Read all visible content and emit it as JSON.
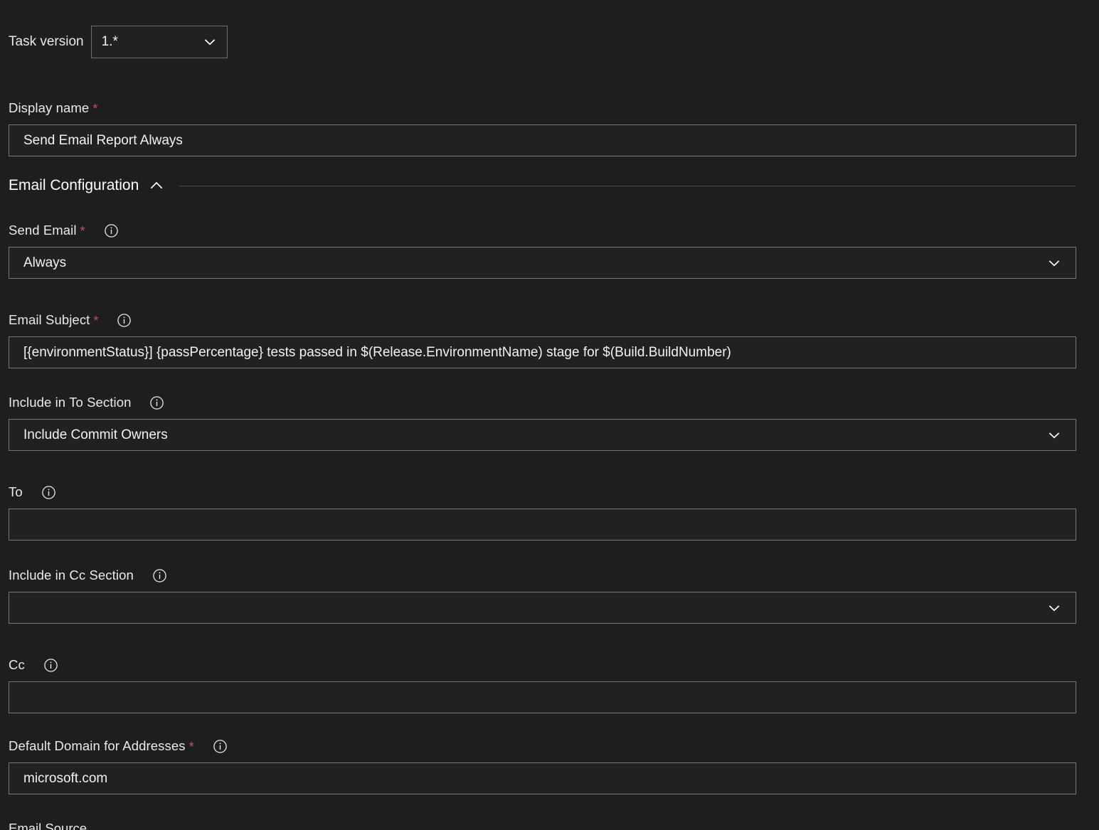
{
  "task_version": {
    "label": "Task version",
    "value": "1.*",
    "chevron_icon": "chevron-down-icon"
  },
  "display_name": {
    "label": "Display name",
    "required": true,
    "value": "Send Email Report Always"
  },
  "section": {
    "title": "Email Configuration",
    "toggle_icon": "chevron-up-icon",
    "expanded": true
  },
  "fields": {
    "send_email": {
      "label": "Send Email",
      "required": true,
      "info_icon": "info-icon",
      "value": "Always",
      "chevron_icon": "chevron-down-icon"
    },
    "email_subject": {
      "label": "Email Subject",
      "required": true,
      "info_icon": "info-icon",
      "value": "[{environmentStatus}] {passPercentage} tests passed in $(Release.EnvironmentName) stage for $(Build.BuildNumber)"
    },
    "include_in_to_section": {
      "label": "Include in To Section",
      "required": false,
      "info_icon": "info-icon",
      "value": "Include Commit Owners",
      "chevron_icon": "chevron-down-icon"
    },
    "to": {
      "label": "To",
      "required": false,
      "info_icon": "info-icon",
      "value": ""
    },
    "include_in_cc_section": {
      "label": "Include in Cc Section",
      "required": false,
      "info_icon": "info-icon",
      "value": "",
      "chevron_icon": "chevron-down-icon"
    },
    "cc": {
      "label": "Cc",
      "required": false,
      "info_icon": "info-icon",
      "value": ""
    },
    "default_domain": {
      "label": "Default Domain for Addresses",
      "required": true,
      "info_icon": "info-icon",
      "value": "microsoft.com"
    },
    "next_partial": {
      "label": "Email Source"
    }
  },
  "colors": {
    "background": "#1e1e1e",
    "field_background": "#212121",
    "border": "#767676",
    "text": "#f2f2f2",
    "required_marker": "#c4506a",
    "divider": "#4a4a4a"
  }
}
